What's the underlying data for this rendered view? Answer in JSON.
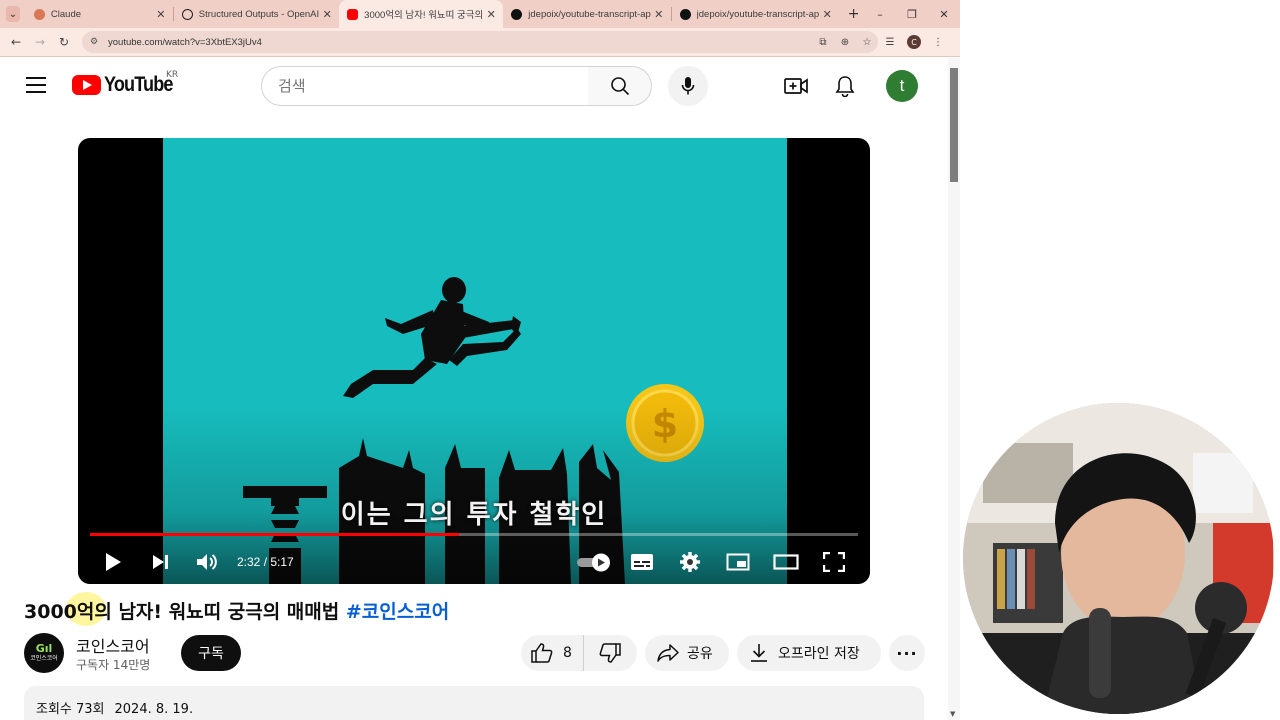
{
  "browser": {
    "tabs": [
      {
        "title": "Claude",
        "active": false,
        "favicon_color": "#d97757"
      },
      {
        "title": "Structured Outputs - OpenAI",
        "active": false,
        "favicon_color": "#222222"
      },
      {
        "title": "3000억의 남자! 워뇨띠 궁극의",
        "active": true,
        "favicon_color": "#ff0000"
      },
      {
        "title": "jdepoix/youtube-transcript-ap",
        "active": false,
        "favicon_color": "#111111"
      },
      {
        "title": "jdepoix/youtube-transcript-ap",
        "active": false,
        "favicon_color": "#111111"
      }
    ],
    "url": "youtube.com/watch?v=3XbtEX3jUv4",
    "profile_initial": "C"
  },
  "header": {
    "region": "KR",
    "search_placeholder": "검색",
    "avatar_initial": "t",
    "avatar_color": "#2e7d32"
  },
  "player": {
    "subtitle": "이는 그의 투자 철학인",
    "current_time": "2:32",
    "duration": "5:17",
    "progress": 0.48,
    "frame_color": "#17bdbe"
  },
  "video": {
    "title": "3000억의 남자! 워뇨띠 궁극의 매매법",
    "hashtag": "#코인스코어",
    "channel_name": "코인스코어",
    "subscribers": "구독자 14만명",
    "subscribe_label": "구독",
    "likes": "8",
    "share_label": "공유",
    "offline_label": "오프라인 저장",
    "views": "조회수 73회",
    "date": "2024. 8. 19.",
    "channel_avatar_text": "코인스코어"
  }
}
